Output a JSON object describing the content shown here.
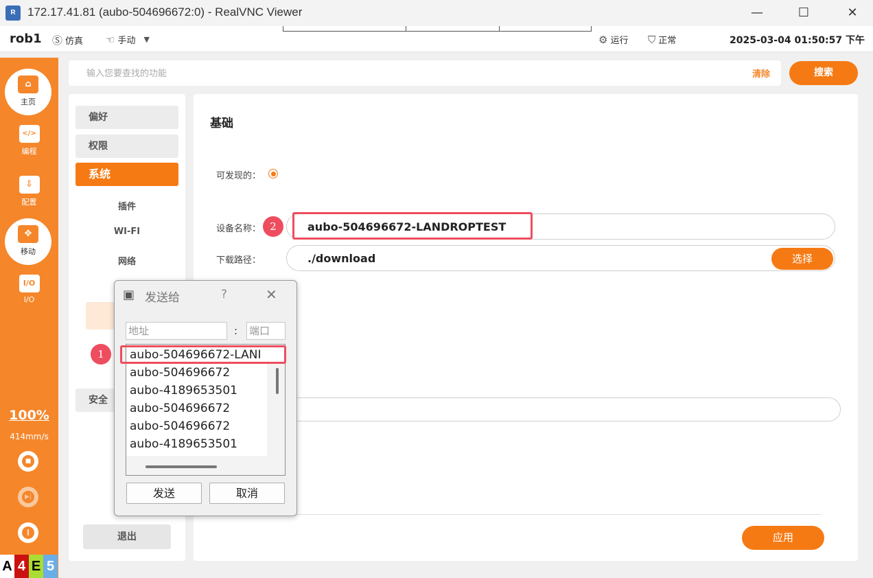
{
  "window": {
    "title": "172.17.41.81 (aubo-504696672:0) - RealVNC Viewer",
    "app_icon": "R",
    "controls": {
      "minimize": "—",
      "maximize": "☐",
      "close": "✕"
    }
  },
  "topbar": {
    "robot": "rob1",
    "sim_label": "仿真",
    "mode_label": "手动",
    "run_label": "运行",
    "status_label": "正常",
    "datetime": "2025-03-04 01:50:57 下午"
  },
  "sidebar": {
    "items": [
      {
        "label": "主页",
        "icon": "home-icon",
        "glyph": "⌂"
      },
      {
        "label": "编程",
        "icon": "code-icon",
        "glyph": "</>"
      },
      {
        "label": "配置",
        "icon": "download-icon",
        "glyph": "⇩"
      },
      {
        "label": "移动",
        "icon": "move-icon",
        "glyph": "✥"
      },
      {
        "label": "I/O",
        "icon": "io-icon",
        "glyph": "I/O"
      }
    ],
    "speed_percent": "100%",
    "speed_value": "414mm/s",
    "badges": [
      {
        "text": "A",
        "bg": "#ffffff",
        "color": "#000000"
      },
      {
        "text": "4",
        "bg": "#cc1111",
        "color": "#ffffff"
      },
      {
        "text": "E",
        "bg": "#aadd33",
        "color": "#000000"
      },
      {
        "text": "5",
        "bg": "#6aaee8",
        "color": "#ffffff"
      }
    ]
  },
  "search": {
    "placeholder": "输入您要查找的功能",
    "clear_label": "清除",
    "search_label": "搜索"
  },
  "menu": {
    "items": [
      "偏好",
      "权限",
      "系统"
    ],
    "sub_items": [
      "插件",
      "WI-FI",
      "网络"
    ],
    "safety": "安全",
    "exit": "退出"
  },
  "content": {
    "section_title": "基础",
    "discoverable_label": "可发现的：",
    "device_name_label": "设备名称：",
    "device_name_value": "aubo-504696672-LANDROPTEST",
    "download_path_label": "下载路径：",
    "download_path_value": "./download",
    "select_label": "选择",
    "apply_label": "应用"
  },
  "annotations": {
    "one": "1",
    "two": "2"
  },
  "dialog": {
    "title": "发送给",
    "help": "?",
    "close": "✕",
    "address_placeholder": "地址",
    "colon": ":",
    "port_placeholder": "端口",
    "list": [
      "aubo-504696672-LANI",
      "aubo-504696672",
      "aubo-4189653501",
      "aubo-504696672",
      "aubo-504696672",
      "aubo-4189653501"
    ],
    "send_label": "发送",
    "cancel_label": "取消"
  },
  "colors": {
    "accent": "#f57a14",
    "sidebar": "#f5862a",
    "annotation": "#ee4d5f"
  }
}
